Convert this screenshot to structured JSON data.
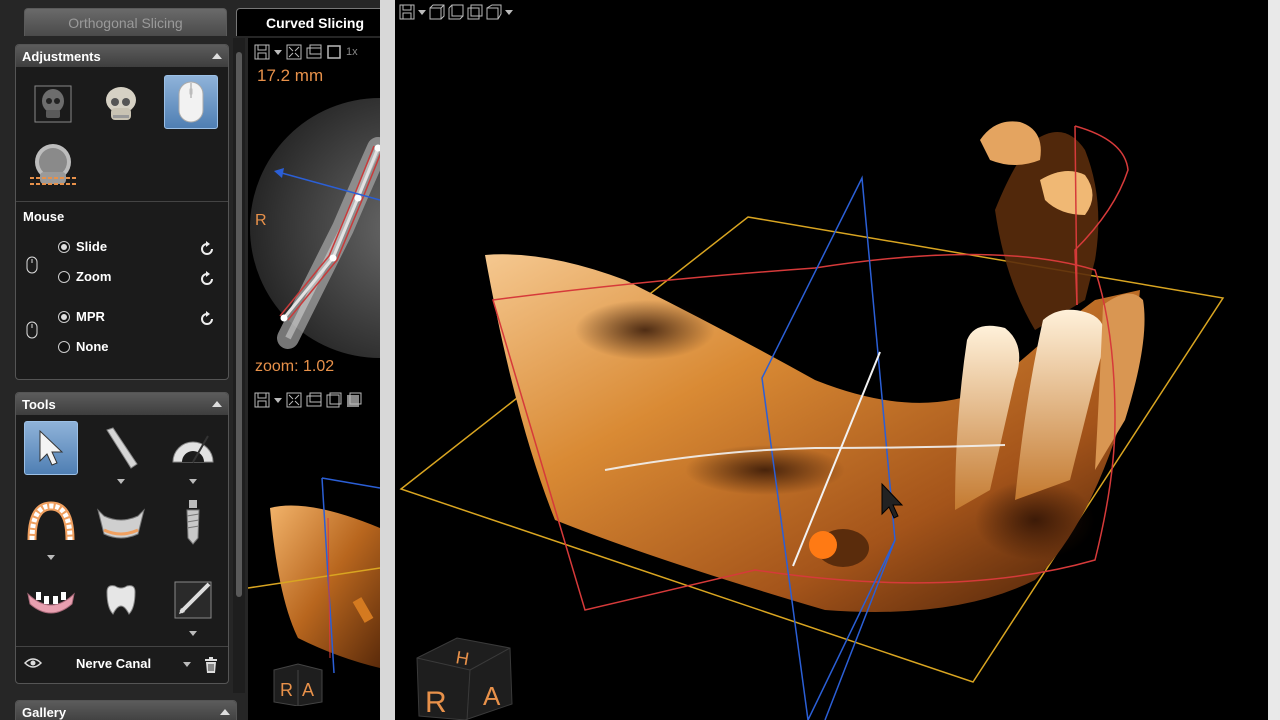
{
  "tabs": {
    "orthogonal": "Orthogonal Slicing",
    "curved": "Curved Slicing"
  },
  "adjustments": {
    "title": "Adjustments",
    "icons": [
      "skull-xray-icon",
      "skull-3d-icon",
      "mouse-icon",
      "skull-head-icon"
    ]
  },
  "mouse": {
    "label": "Mouse",
    "group1": {
      "option1": "Slide",
      "option2": "Zoom",
      "selected": "Slide"
    },
    "group2": {
      "option1": "MPR",
      "option2": "None",
      "selected": "MPR"
    }
  },
  "tools": {
    "title": "Tools",
    "icons": [
      "pointer-icon",
      "ruler-icon",
      "protractor-icon",
      "dental-arch-icon",
      "mandible-panoramic-icon",
      "implant-icon",
      "jaw-model-icon",
      "tooth-crown-icon",
      "annotate-pen-icon"
    ],
    "layer_name": "Nerve Canal"
  },
  "gallery": {
    "title": "Gallery"
  },
  "curved_view": {
    "thickness": "17.2 mm",
    "side_label": "R",
    "zoom": "zoom: 1.02",
    "zoom_abbrev": "1x"
  },
  "orientation_cube": {
    "faces": [
      "H",
      "R",
      "A"
    ],
    "small_faces": [
      "R",
      "A"
    ]
  },
  "colors": {
    "accent_blue": "#4f7fb3",
    "annotation_orange": "#e8914a",
    "plane_blue": "#2b5fd6",
    "plane_red": "#d63a3a",
    "plane_yellow": "#d9a521"
  }
}
